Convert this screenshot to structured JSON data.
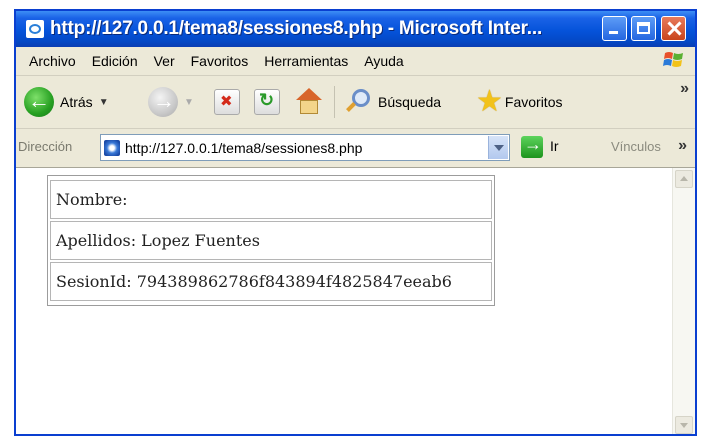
{
  "window": {
    "title": "http://127.0.0.1/tema8/sessiones8.php - Microsoft Inter..."
  },
  "menu": [
    "Archivo",
    "Edición",
    "Ver",
    "Favoritos",
    "Herramientas",
    "Ayuda"
  ],
  "toolbar": {
    "back_label": "Atrás",
    "search_label": "Búsqueda",
    "favorites_label": "Favoritos"
  },
  "address": {
    "label": "Dirección",
    "url": "http://127.0.0.1/tema8/sessiones8.php",
    "go_label": "Ir",
    "links_label": "Vínculos"
  },
  "content": {
    "rows": [
      "Nombre:",
      "Apellidos: Lopez Fuentes",
      "SesionId: 794389862786f843894f4825847eeab6"
    ]
  }
}
